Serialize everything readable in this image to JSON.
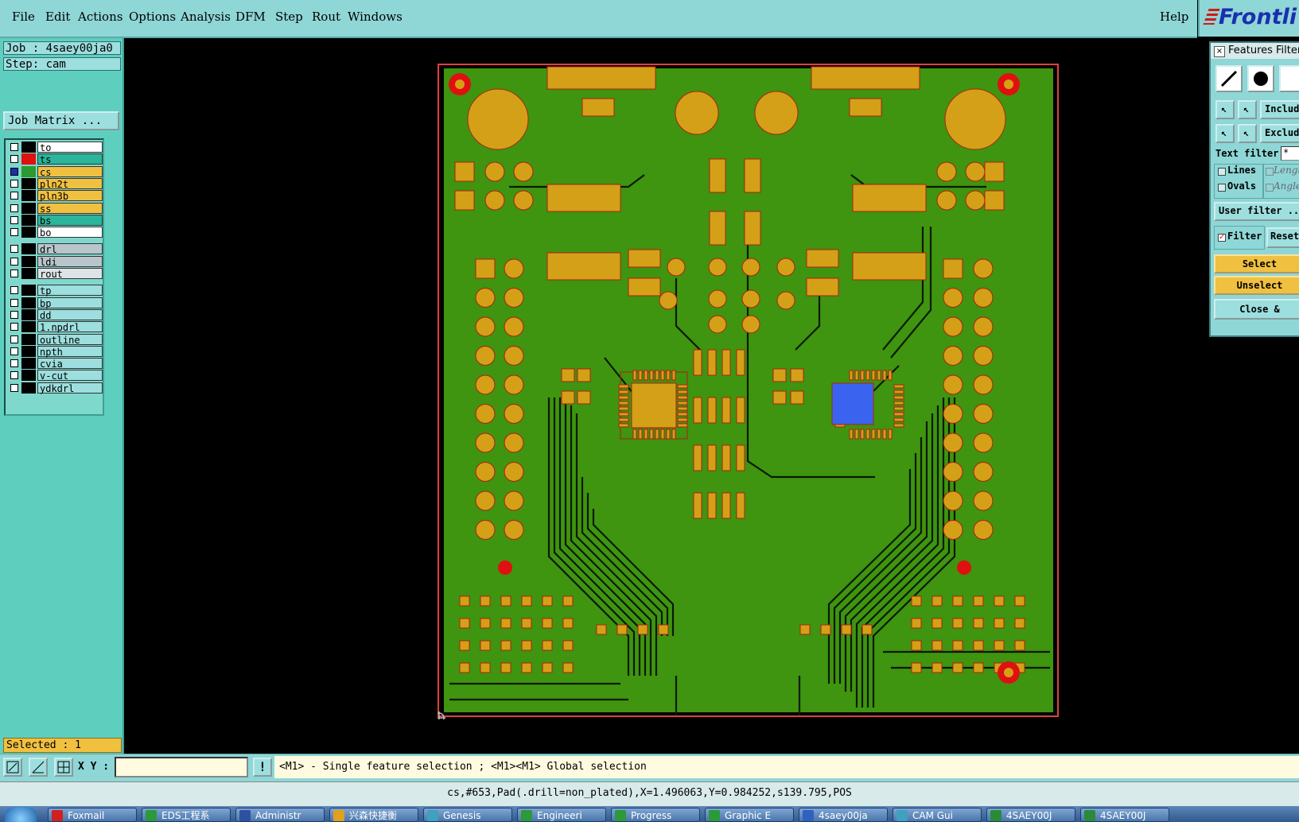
{
  "menu": {
    "items": [
      "File",
      "Edit",
      "Actions",
      "Options",
      "Analysis",
      "DFM",
      "Step",
      "Rout",
      "Windows"
    ],
    "help": "Help"
  },
  "logo": "Frontli",
  "job": {
    "job_label": "Job : 4saey00ja0",
    "step_label": "Step: cam",
    "matrix_button": "Job Matrix ..."
  },
  "layers": [
    {
      "name": "to",
      "bg": "#ffffff",
      "color": "#000000"
    },
    {
      "name": "ts",
      "bg": "#2bb59a",
      "color": "#e01010"
    },
    {
      "name": "cs",
      "bg": "#f0c040",
      "color": "#2b9a30",
      "active": true
    },
    {
      "name": "pln2t",
      "bg": "#f0c040",
      "color": "#000000"
    },
    {
      "name": "pln3b",
      "bg": "#f0c040",
      "color": "#000000"
    },
    {
      "name": "ss",
      "bg": "#f0c040",
      "color": "#000000"
    },
    {
      "name": "bs",
      "bg": "#2bb59a",
      "color": "#000000"
    },
    {
      "name": "bo",
      "bg": "#ffffff",
      "color": "#000000"
    },
    {
      "name": "drl",
      "bg": "#b8c6cc",
      "color": "#000000"
    },
    {
      "name": "ldi",
      "bg": "#b8c6cc",
      "color": "#000000"
    },
    {
      "name": "rout",
      "bg": "#dde3e6",
      "color": "#000000"
    },
    {
      "name": "tp",
      "bg": "#9ddede",
      "color": "#000000"
    },
    {
      "name": "bp",
      "bg": "#9ddede",
      "color": "#000000"
    },
    {
      "name": "dd",
      "bg": "#9ddede",
      "color": "#000000"
    },
    {
      "name": "1.npdrl",
      "bg": "#9ddede",
      "color": "#000000"
    },
    {
      "name": "outline",
      "bg": "#9ddede",
      "color": "#000000"
    },
    {
      "name": "npth",
      "bg": "#9ddede",
      "color": "#000000"
    },
    {
      "name": "cvia",
      "bg": "#9ddede",
      "color": "#000000"
    },
    {
      "name": "v-cut",
      "bg": "#9ddede",
      "color": "#000000"
    },
    {
      "name": "ydkdrl",
      "bg": "#9ddede",
      "color": "#000000"
    }
  ],
  "selected_label": "Selected : 1",
  "filter_panel": {
    "title": "Features Filter",
    "include": "Includ",
    "exclude": "Exclud",
    "text_filter_label": "Text filter",
    "text_filter_value": "*",
    "lines": "Lines",
    "ovals": "Ovals",
    "length": "Lengt",
    "angle": "Angle",
    "user_filter": "User filter ...",
    "filter": "Filter",
    "reset": "Reset",
    "select": "Select",
    "unselect": "Unselect",
    "close": "Close &"
  },
  "coord": {
    "label": "X Y :",
    "value": "",
    "bang": "!"
  },
  "message": "<M1> - Single feature selection ; <M1><M1> Global selection",
  "status": "cs,#653,Pad(.drill=non_plated),X=1.496063,Y=0.984252,s139.795,POS",
  "taskbar": [
    {
      "label": "Foxmail",
      "icon": "#d02020"
    },
    {
      "label": "EDS工程系",
      "icon": "#2a9a3a"
    },
    {
      "label": "Administr",
      "icon": "#3050a0"
    },
    {
      "label": "兴森快捷衡",
      "icon": "#e0a020"
    },
    {
      "label": "Genesis",
      "icon": "#40a0c0"
    },
    {
      "label": "Engineeri",
      "icon": "#2a9a3a"
    },
    {
      "label": "Progress",
      "icon": "#2a9a3a"
    },
    {
      "label": "Graphic E",
      "icon": "#2a9a3a"
    },
    {
      "label": "4saey00ja",
      "icon": "#3060c0"
    },
    {
      "label": "CAM Gui",
      "icon": "#40a0c0"
    },
    {
      "label": "4SAEY00J",
      "icon": "#2a8a3a"
    },
    {
      "label": "4SAEY00J",
      "icon": "#2a8a3a"
    }
  ],
  "colors": {
    "board_fill": "#3f9410",
    "copper": "#d4a017",
    "copper_outline": "#b02010",
    "trace": "#0a1a05",
    "board_outline": "#e04040",
    "highlight_pad": "#3a64f0",
    "fiducial": "#e01010"
  },
  "icons": {
    "line_tool": "line-icon",
    "pad_tool": "circle-pad-icon",
    "zoom": "zoom-icon",
    "measure": "measure-icon",
    "snap": "snap-icon"
  }
}
